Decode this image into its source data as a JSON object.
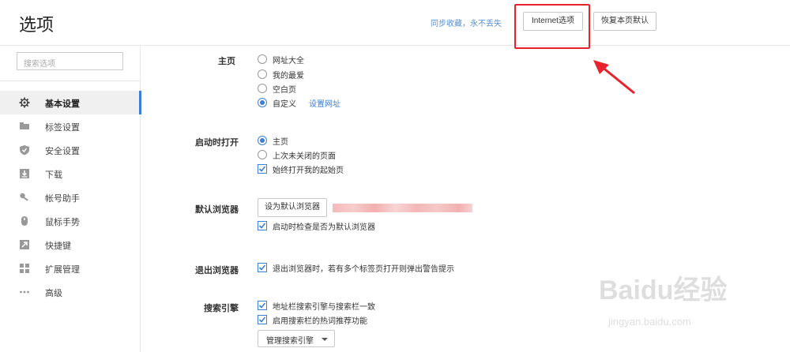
{
  "header": {
    "title": "选项",
    "sync_link": "同步收藏，永不丢失",
    "internet_options_label": "Internet选项",
    "restore_defaults_label": "恢复本页默认"
  },
  "colors": {
    "accent": "#3b7fd9",
    "annotation": "#e8232d"
  },
  "sidebar": {
    "search_placeholder": "搜索选项",
    "items": [
      {
        "label": "基本设置",
        "icon": "gear-icon",
        "active": true
      },
      {
        "label": "标签设置",
        "icon": "tab-icon"
      },
      {
        "label": "安全设置",
        "icon": "shield-icon"
      },
      {
        "label": "下载",
        "icon": "download-icon"
      },
      {
        "label": "帐号助手",
        "icon": "key-icon"
      },
      {
        "label": "鼠标手势",
        "icon": "mouse-icon"
      },
      {
        "label": "快捷键",
        "icon": "shortcut-icon"
      },
      {
        "label": "扩展管理",
        "icon": "extensions-icon"
      },
      {
        "label": "高级",
        "icon": "more-icon"
      }
    ]
  },
  "sections": {
    "homepage": {
      "label": "主页",
      "options": [
        "网址大全",
        "我的最爱",
        "空白页",
        "自定义"
      ],
      "selected": "自定义",
      "set_url_link": "设置网址"
    },
    "startup": {
      "label": "启动时打开",
      "options": [
        "主页",
        "上次未关闭的页面"
      ],
      "selected": "主页",
      "always_open_start": "始终打开我的起始页"
    },
    "default_browser": {
      "label": "默认浏览器",
      "button": "设为默认浏览器",
      "check_on_start": "启动时检查是否为默认浏览器"
    },
    "exit_browser": {
      "label": "退出浏览器",
      "warn_multiple_tabs": "退出浏览器时，若有多个标签页打开则弹出警告提示"
    },
    "search_engine": {
      "label": "搜索引擎",
      "sync_address_bar": "地址栏搜索引擎与搜索栏一致",
      "hot_words": "启用搜索栏的热词推荐功能",
      "manage_button": "管理搜索引擎"
    }
  },
  "watermark": {
    "brand": "Baidu经验",
    "url": "jingyan.baidu.com"
  }
}
